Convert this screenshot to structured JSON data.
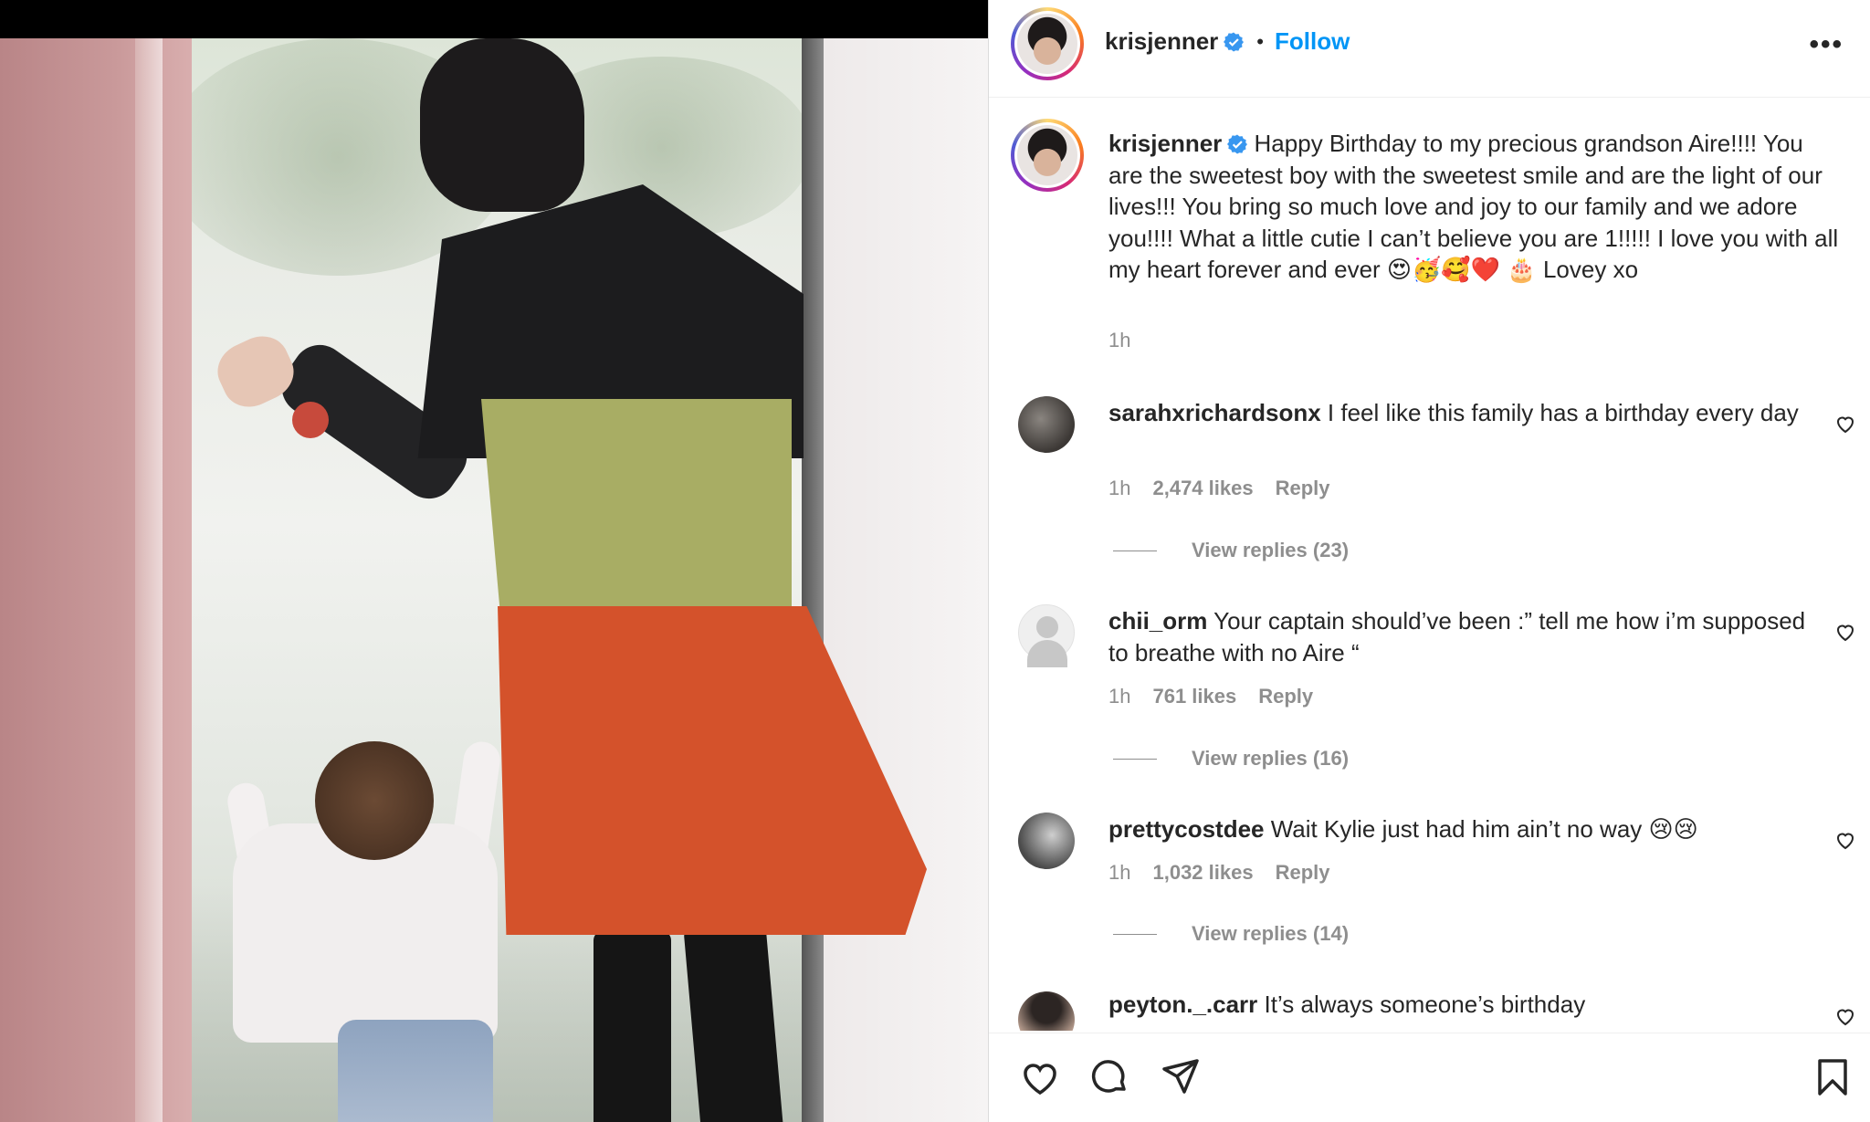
{
  "post": {
    "author": "krisjenner",
    "verified_icon": "verified-badge-icon",
    "follow_label": "Follow",
    "separator": "•",
    "more_label": "•••"
  },
  "caption": {
    "username": "krisjenner",
    "text": "Happy Birthday to my precious grandson Aire!!!! You are the sweetest boy with the sweetest smile and are the light of our lives!!! You bring so much love and joy to our family and we adore you!!!! What a little cutie I can’t believe you are 1!!!!! I love you with all my heart forever and ever 😍🥳🥰❤️ 🎂 Lovey xo",
    "time": "1h"
  },
  "comments": [
    {
      "username": "sarahxrichardsonx",
      "text": "I feel like this family has a birthday every day",
      "time": "1h",
      "likes": "2,474 likes",
      "reply_label": "Reply",
      "view_replies": "View replies (23)"
    },
    {
      "username": "chii_orm",
      "text": "Your captain should’ve been :” tell me how i’m supposed to breathe with no Aire “",
      "time": "1h",
      "likes": "761 likes",
      "reply_label": "Reply",
      "view_replies": "View replies (16)"
    },
    {
      "username": "prettycostdee",
      "text": "Wait Kylie just had him ain’t no way 😢😢",
      "time": "1h",
      "likes": "1,032 likes",
      "reply_label": "Reply",
      "view_replies": "View replies (14)"
    },
    {
      "username": "peyton._.carr",
      "text": "It’s always someone’s birthday"
    }
  ],
  "actions": [
    "heart-icon",
    "comment-icon",
    "share-icon",
    "bookmark-icon"
  ],
  "colors": {
    "link": "#0095f6",
    "secondary": "#8e8e8e",
    "text": "#262626"
  }
}
